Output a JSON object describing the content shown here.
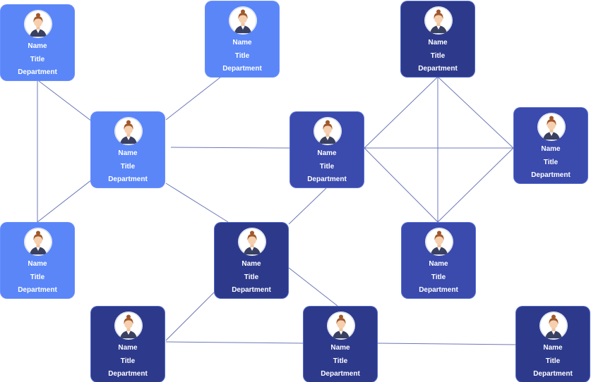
{
  "colors": {
    "light": "#5a86f8",
    "medium": "#3a4aad",
    "dark": "#2d3a8c",
    "link": "#6c78b8"
  },
  "nodes": [
    {
      "name": "Name",
      "title": "Title",
      "department": "Department",
      "shade": "light"
    },
    {
      "name": "Name",
      "title": "Title",
      "department": "Department",
      "shade": "light"
    },
    {
      "name": "Name",
      "title": "Title",
      "department": "Department",
      "shade": "dark"
    },
    {
      "name": "Name",
      "title": "Title",
      "department": "Department",
      "shade": "light"
    },
    {
      "name": "Name",
      "title": "Title",
      "department": "Department",
      "shade": "medium"
    },
    {
      "name": "Name",
      "title": "Title",
      "department": "Department",
      "shade": "medium"
    },
    {
      "name": "Name",
      "title": "Title",
      "department": "Department",
      "shade": "light"
    },
    {
      "name": "Name",
      "title": "Title",
      "department": "Department",
      "shade": "dark"
    },
    {
      "name": "Name",
      "title": "Title",
      "department": "Department",
      "shade": "medium"
    },
    {
      "name": "Name",
      "title": "Title",
      "department": "Department",
      "shade": "dark"
    },
    {
      "name": "Name",
      "title": "Title",
      "department": "Department",
      "shade": "dark"
    },
    {
      "name": "Name",
      "title": "Title",
      "department": "Department",
      "shade": "dark"
    }
  ],
  "links": [
    [
      0,
      6
    ],
    [
      0,
      3
    ],
    [
      1,
      3
    ],
    [
      3,
      4
    ],
    [
      3,
      6
    ],
    [
      3,
      7
    ],
    [
      7,
      4
    ],
    [
      4,
      5
    ],
    [
      4,
      2
    ],
    [
      4,
      8
    ],
    [
      2,
      8
    ],
    [
      2,
      5
    ],
    [
      8,
      5
    ],
    [
      7,
      10
    ],
    [
      7,
      9
    ],
    [
      9,
      10
    ],
    [
      10,
      11
    ]
  ],
  "avatar_icon": "female-person-icon"
}
